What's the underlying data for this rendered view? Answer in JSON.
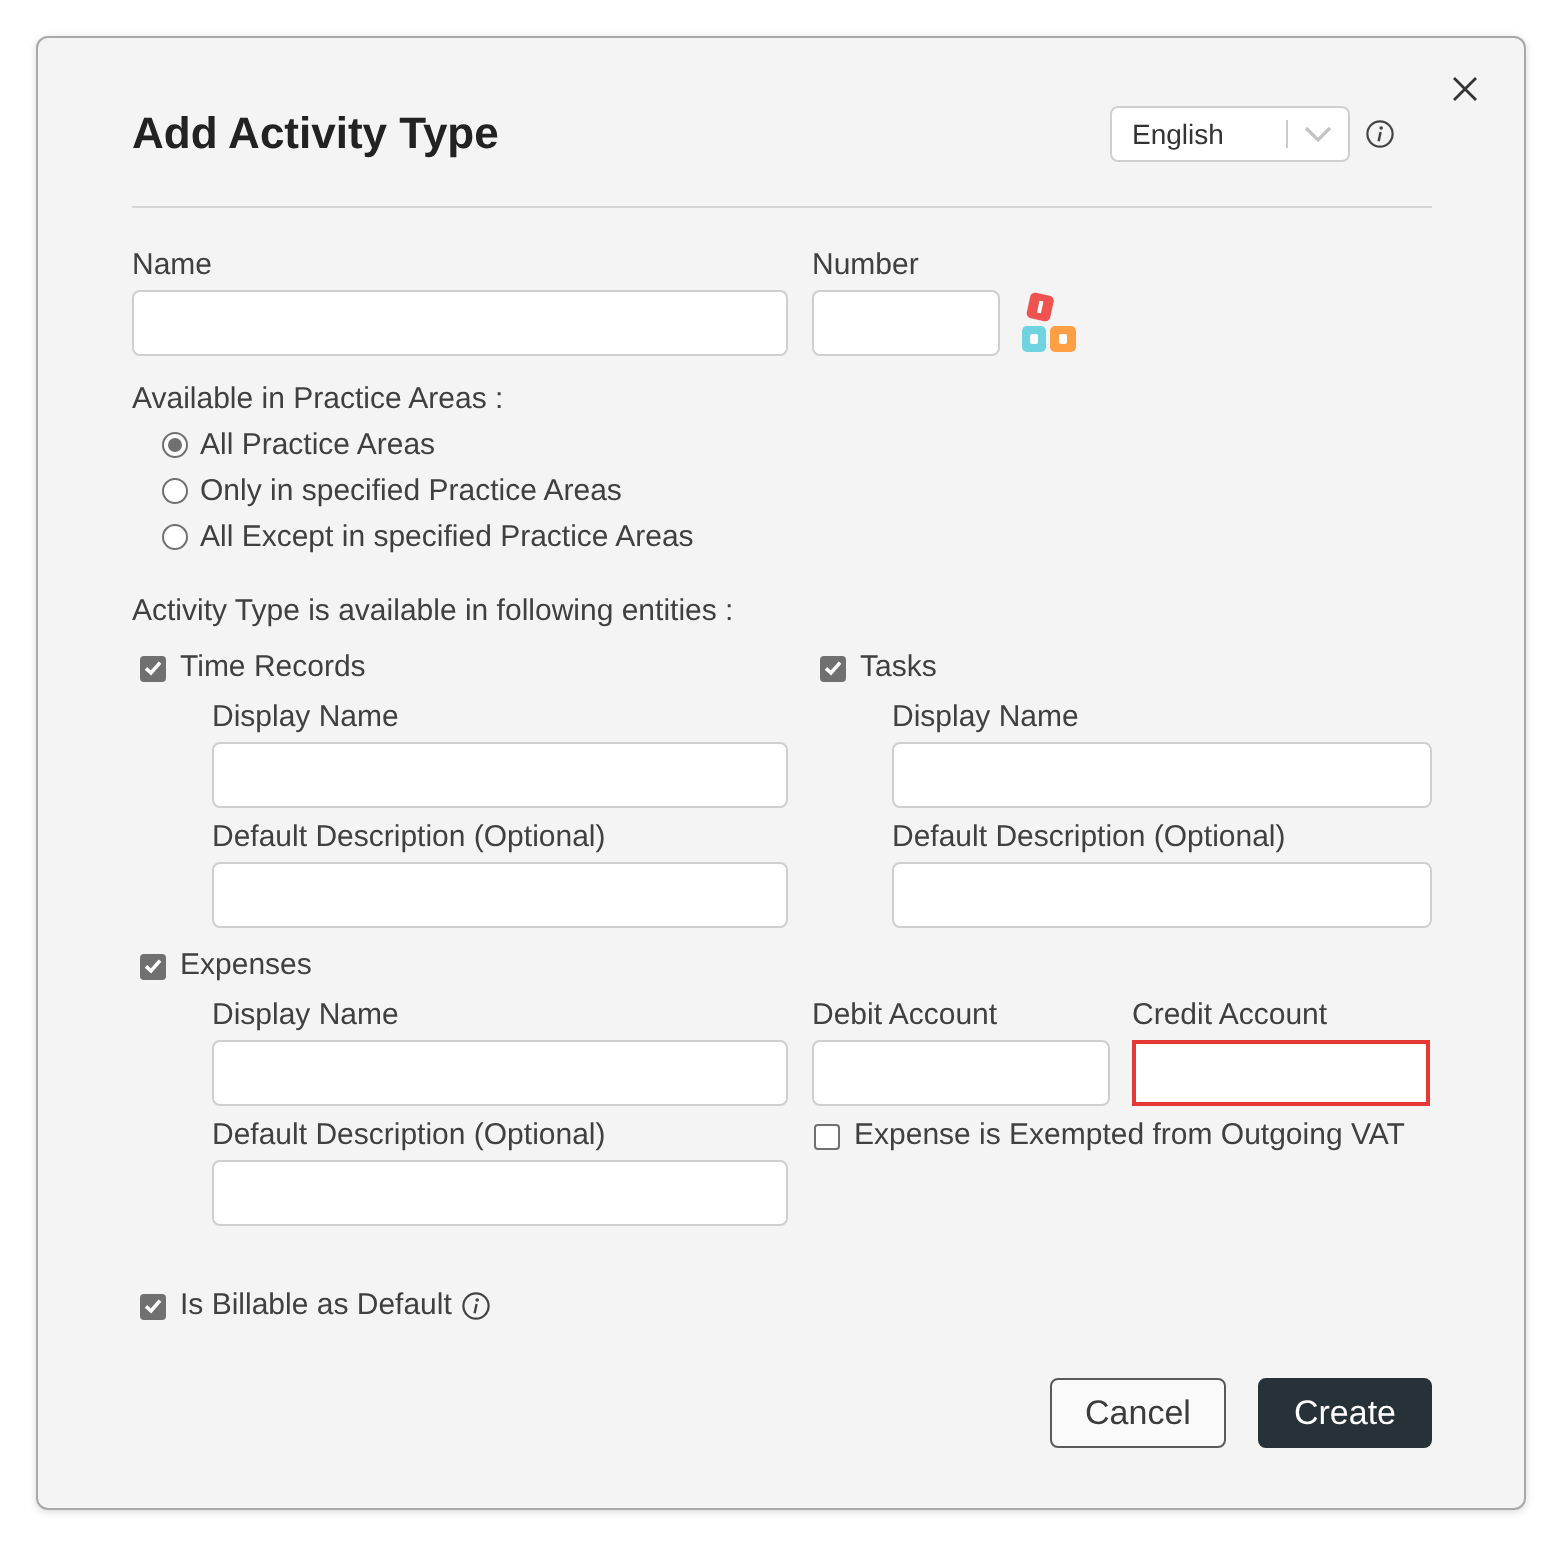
{
  "dialog": {
    "title": "Add Activity Type"
  },
  "language": {
    "value": "English"
  },
  "name_field": {
    "label": "Name"
  },
  "number_field": {
    "label": "Number"
  },
  "practice_areas": {
    "label": "Available in Practice Areas :",
    "options": [
      {
        "label": "All Practice Areas",
        "selected": true
      },
      {
        "label": "Only in specified Practice Areas",
        "selected": false
      },
      {
        "label": "All Except in specified Practice Areas",
        "selected": false
      }
    ]
  },
  "entities": {
    "label": "Activity Type is available in following entities :",
    "items": [
      {
        "kind": "simple",
        "label": "Time Records",
        "checked": true,
        "fields": [
          {
            "label": "Display Name"
          },
          {
            "label": "Default Description (Optional)"
          }
        ]
      },
      {
        "kind": "simple",
        "label": "Tasks",
        "checked": true,
        "fields": [
          {
            "label": "Display Name"
          },
          {
            "label": "Default Description (Optional)"
          }
        ]
      },
      {
        "kind": "expense",
        "label": "Expenses",
        "checked": true,
        "fields": [
          {
            "label": "Display Name"
          },
          {
            "label": "Default Description (Optional)"
          }
        ],
        "accounts": [
          {
            "label": "Debit Account",
            "invalid": false
          },
          {
            "label": "Credit Account",
            "invalid": true
          }
        ],
        "exempt": {
          "label": "Expense is Exempted from Outgoing VAT",
          "checked": false
        }
      }
    ]
  },
  "billable": {
    "label": "Is Billable as Default",
    "checked": true
  },
  "buttons": [
    {
      "label": "Cancel",
      "kind": "secondary"
    },
    {
      "label": "Create",
      "kind": "primary"
    }
  ]
}
